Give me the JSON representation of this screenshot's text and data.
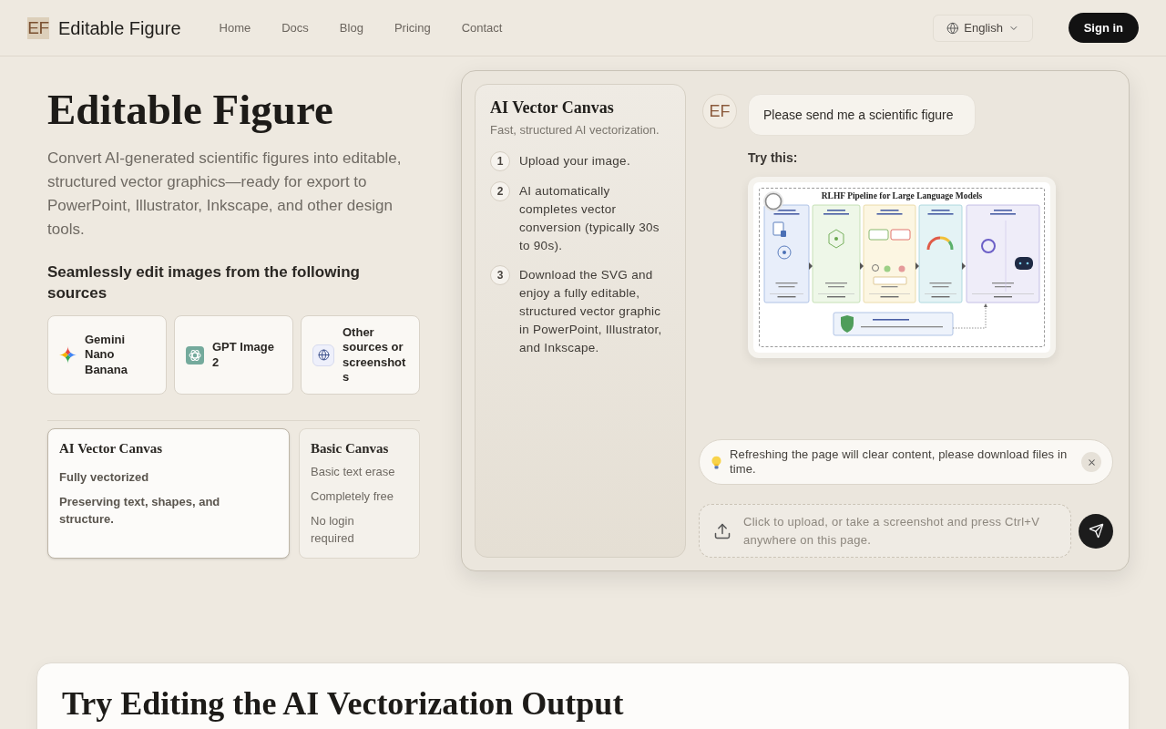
{
  "header": {
    "logo": "EF",
    "brand": "Editable Figure",
    "nav": [
      "Home",
      "Docs",
      "Blog",
      "Pricing",
      "Contact"
    ],
    "language": "English",
    "sign_in": "Sign in"
  },
  "hero": {
    "title": "Editable Figure",
    "description": "Convert AI-generated scientific figures into editable, structured vector graphics—ready for export to PowerPoint, Illustrator, Inkscape, and other design tools.",
    "sources_heading": "Seamlessly edit images from the following sources",
    "sources": [
      {
        "kind": "gemini",
        "label": "Gemini Nano Banana"
      },
      {
        "kind": "gpt",
        "label": "GPT Image 2"
      },
      {
        "kind": "other",
        "label": "Other sources or screenshots"
      }
    ],
    "canvases": [
      {
        "title": "AI Vector Canvas",
        "selected": true,
        "features": [
          "Fully vectorized",
          "Preserving text, shapes, and structure."
        ]
      },
      {
        "title": "Basic Canvas",
        "selected": false,
        "features": [
          "Basic text erase",
          "Completely free",
          "No login required"
        ]
      }
    ]
  },
  "workspace": {
    "guide": {
      "title": "AI Vector Canvas",
      "subtitle": "Fast, structured AI vectorization.",
      "steps": [
        {
          "number": "1",
          "text": "Upload your image."
        },
        {
          "number": "2",
          "text": "AI automatically completes vector conversion (typically 30s to 90s)."
        },
        {
          "number": "3",
          "text": "Download the SVG and enjoy a fully editable, structured vector graphic in PowerPoint, Illustrator, and Inkscape."
        }
      ]
    },
    "chat": {
      "avatar": "EF",
      "message": "Please send me a scientific figure",
      "try_label": "Try this:",
      "example_figure_title": "RLHF Pipeline for Large Language Models"
    },
    "notice": "Refreshing the page will clear content, please download files in time.",
    "upload": {
      "placeholder": "Click to upload, or take a screenshot and press Ctrl+V anywhere on this page."
    }
  },
  "demo_section": {
    "title": "Try Editing the AI Vectorization Output"
  }
}
